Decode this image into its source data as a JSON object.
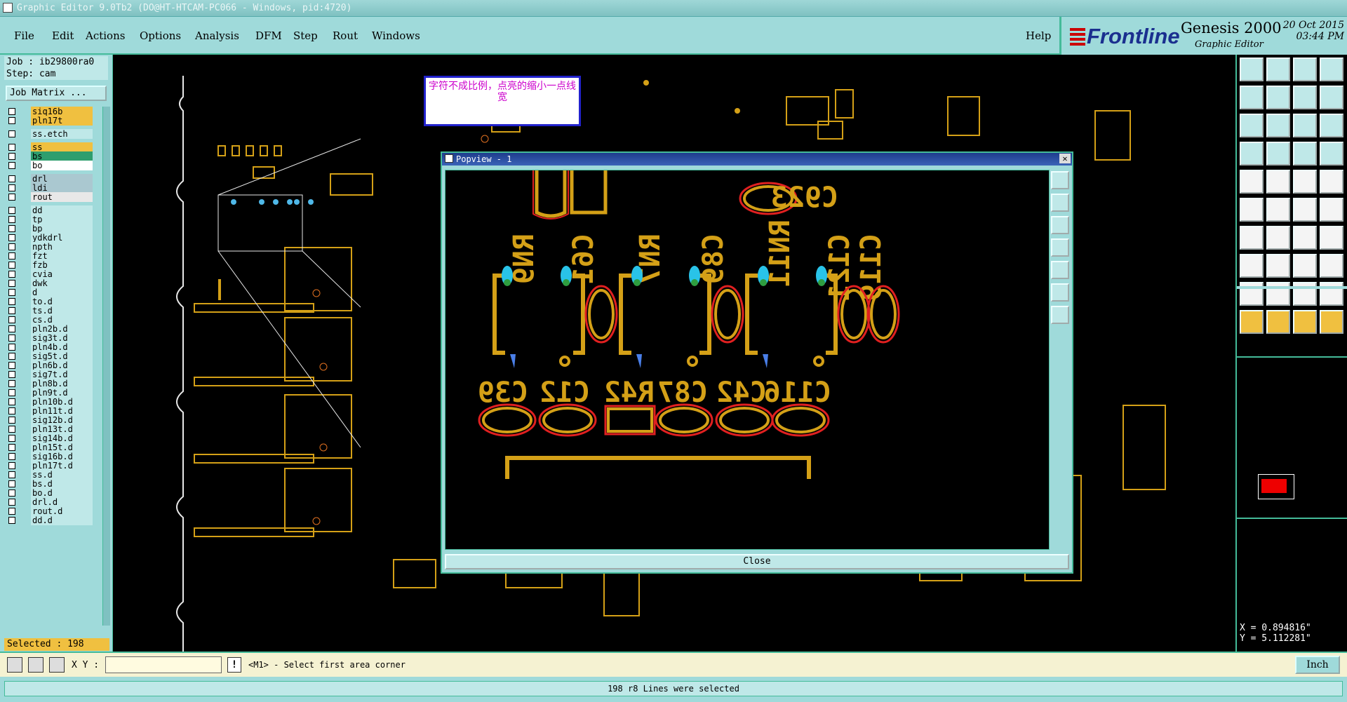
{
  "window": {
    "title": "Graphic Editor 9.0Tb2 (DO@HT-HTCAM-PC066 - Windows, pid:4720)"
  },
  "menu": [
    "File",
    "Edit",
    "Actions",
    "Options",
    "Analysis",
    "DFM",
    "Step",
    "Rout",
    "Windows"
  ],
  "help": "Help",
  "brand": {
    "logo": "Frontline",
    "product": "Genesis 2000",
    "subtitle": "Graphic Editor",
    "date": "20 Oct 2015",
    "time": "03:44 PM"
  },
  "job": {
    "job": "Job : ib29800ra0",
    "step": "Step: cam",
    "matrix_button": "Job Matrix ..."
  },
  "layers": [
    {
      "name": "siq16b",
      "color": "#f0c040"
    },
    {
      "name": "pln17t",
      "color": "#f0c040"
    },
    {
      "name": "ss.etch",
      "color": "#bfe8e8"
    },
    {
      "name": "ss",
      "color": "#f0c040"
    },
    {
      "name": "bs",
      "color": "#2e9e6e"
    },
    {
      "name": "bo",
      "color": "#ffffff"
    },
    {
      "name": "drl",
      "color": "#aac8d0"
    },
    {
      "name": "ldi",
      "color": "#aac8d0"
    },
    {
      "name": "rout",
      "color": "#e8e8e8"
    },
    {
      "name": "dd",
      "color": "#bfe8e8"
    },
    {
      "name": "tp",
      "color": "#bfe8e8"
    },
    {
      "name": "bp",
      "color": "#bfe8e8"
    },
    {
      "name": "ydkdrl",
      "color": "#bfe8e8"
    },
    {
      "name": "npth",
      "color": "#bfe8e8"
    },
    {
      "name": "fzt",
      "color": "#bfe8e8"
    },
    {
      "name": "fzb",
      "color": "#bfe8e8"
    },
    {
      "name": "cvia",
      "color": "#bfe8e8"
    },
    {
      "name": "dwk",
      "color": "#bfe8e8"
    },
    {
      "name": "d",
      "color": "#bfe8e8"
    },
    {
      "name": "to.d",
      "color": "#bfe8e8"
    },
    {
      "name": "ts.d",
      "color": "#bfe8e8"
    },
    {
      "name": "cs.d",
      "color": "#bfe8e8"
    },
    {
      "name": "pln2b.d",
      "color": "#bfe8e8"
    },
    {
      "name": "sig3t.d",
      "color": "#bfe8e8"
    },
    {
      "name": "pln4b.d",
      "color": "#bfe8e8"
    },
    {
      "name": "sig5t.d",
      "color": "#bfe8e8"
    },
    {
      "name": "pln6b.d",
      "color": "#bfe8e8"
    },
    {
      "name": "sig7t.d",
      "color": "#bfe8e8"
    },
    {
      "name": "pln8b.d",
      "color": "#bfe8e8"
    },
    {
      "name": "pln9t.d",
      "color": "#bfe8e8"
    },
    {
      "name": "pln10b.d",
      "color": "#bfe8e8"
    },
    {
      "name": "pln11t.d",
      "color": "#bfe8e8"
    },
    {
      "name": "sig12b.d",
      "color": "#bfe8e8"
    },
    {
      "name": "pln13t.d",
      "color": "#bfe8e8"
    },
    {
      "name": "sig14b.d",
      "color": "#bfe8e8"
    },
    {
      "name": "pln15t.d",
      "color": "#bfe8e8"
    },
    {
      "name": "sig16b.d",
      "color": "#bfe8e8"
    },
    {
      "name": "pln17t.d",
      "color": "#bfe8e8"
    },
    {
      "name": "ss.d",
      "color": "#bfe8e8"
    },
    {
      "name": "bs.d",
      "color": "#bfe8e8"
    },
    {
      "name": "bo.d",
      "color": "#bfe8e8"
    },
    {
      "name": "drl.d",
      "color": "#bfe8e8"
    },
    {
      "name": "rout.d",
      "color": "#bfe8e8"
    },
    {
      "name": "dd.d",
      "color": "#bfe8e8"
    }
  ],
  "selected": "Selected : 198",
  "note": "字符不成比例，点亮的缩小一点线宽",
  "popview": {
    "title": "Popview - 1",
    "close": "Close",
    "labels_top": [
      "RN9",
      "C61",
      "RN7",
      "C89",
      "RN11",
      "C121",
      "C119",
      "C923"
    ],
    "labels_bottom": [
      "C39",
      "C12",
      "R42",
      "C87",
      "C42",
      "C116"
    ]
  },
  "coords": {
    "x": "X = 0.894816\"",
    "y": "Y = 5.112281\""
  },
  "bottom": {
    "xy_label": "X Y :",
    "prompt": "<M1> - Select first area corner",
    "units": "Inch"
  },
  "status": "198 r8 Lines were selected"
}
